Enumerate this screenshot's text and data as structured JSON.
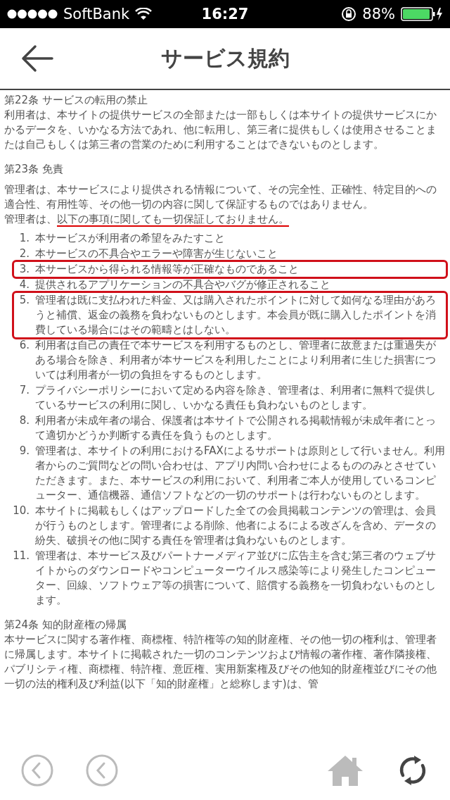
{
  "status_bar": {
    "carrier": "SoftBank",
    "time": "16:27",
    "battery": "88%"
  },
  "header": {
    "title": "サービス規約"
  },
  "sections": [
    {
      "heading": "第22条 サービスの転用の禁止",
      "paragraphs": [
        [
          {
            "text": "利用者は、本サイトの提供サービスの全部または一部もしくは本サイトの提供サービスにかかるデータを、いかなる方法であれ、他に転用し、第三者に提供もしくは使用させることまたは自己もしくは第三者の営業のために利用することはできないものとします。",
            "underlined": false
          }
        ]
      ]
    },
    {
      "heading": "第23条 免責",
      "paragraphs": [
        [
          {
            "text": "管理者は、本サービスにより提供される情報について、その完全性、正確性、特定目的への適合性、有用性等、その他一切の内容に関して保証するものではありません。",
            "underlined": false
          }
        ],
        [
          {
            "text": "管理者は、",
            "underlined": false
          },
          {
            "text": "以下の事項に関しても一切保証しておりません。",
            "underlined": true
          }
        ]
      ],
      "items": [
        {
          "number": "1.",
          "text": "本サービスが利用者の希望をみたすこと",
          "highlighted": false
        },
        {
          "number": "2.",
          "text": "本サービスの不具合やエラーや障害が生じないこと",
          "highlighted": false
        },
        {
          "number": "3.",
          "text": "本サービスから得られる情報等が正確なものであること",
          "highlighted": true
        },
        {
          "number": "4.",
          "text": "提供されるアプリケーションの不具合やバグが修正されること",
          "highlighted": false
        },
        {
          "number": "5.",
          "text": "管理者は既に支払われた料金、又は購入されたポイントに対して如何なる理由があろうと補償、返金の義務を負わないものとします。本会員が既に購入したポイントを消費している場合にはその範疇とはしない。",
          "highlighted": true
        },
        {
          "number": "6.",
          "text": "利用者は自己の責任で本サービスを利用するものとし、管理者に故意または重過失がある場合を除き、利用者が本サービスを利用したことにより利用者に生じた損害については利用者が一切の負担をするものとします。",
          "highlighted": false
        },
        {
          "number": "7.",
          "text": "プライバシーポリシーにおいて定める内容を除き、管理者は、利用者に無料で提供しているサービスの利用に関し、いかなる責任も負わないものとします。",
          "highlighted": false
        },
        {
          "number": "8.",
          "text": "利用者が未成年者の場合、保護者は本サイトで公開される掲載情報が未成年者にとって適切かどうか判断する責任を負うものとします。",
          "highlighted": false
        },
        {
          "number": "9.",
          "text": "管理者は、本サイトの利用におけるFAXによるサポートは原則として行いません。利用者からのご質問などの問い合わせは、アプリ内問い合わせによるもののみとさせていただきます。また、本サービスの利用において、利用者ご本人が使用しているコンピューター、通信機器、通信ソフトなどの一切のサポートは行わないものとします。",
          "highlighted": false
        },
        {
          "number": "10.",
          "text": "本サイトに掲載もしくはアップロードした全ての会員掲載コンテンツの管理は、会員が行うものとします。管理者による削除、他者によるによる改ざんを含め、データの紛失、破損その他に関する責任を管理者は負わないものとします。",
          "highlighted": false
        },
        {
          "number": "11.",
          "text": "管理者は、本サービス及びパートナーメディア並びに広告主を含む第三者のウェブサイトからのダウンロードやコンピューターウイルス感染等により発生したコンピューター、回線、ソフトウェア等の損害について、賠償する義務を一切負わないものとします。",
          "highlighted": false
        }
      ]
    },
    {
      "heading": "第24条 知的財産権の帰属",
      "paragraphs": [
        [
          {
            "text": "本サービスに関する著作権、商標権、特許権等の知的財産権、その他一切の権利は、管理者に帰属します。本サイトに掲載された一切のコンテンツおよび情報の著作権、著作隣接権、パブリシティ権、商標権、特許権、意匠権、実用新案権及びその他知的財産権並びにその他一切の法的権利及び利益(以下「知的財産権」と総称します)は、管",
            "underlined": false
          }
        ]
      ]
    }
  ],
  "toolbar": {
    "back_disabled": true,
    "forward_disabled": true,
    "home_disabled": true,
    "refresh_disabled": false
  }
}
